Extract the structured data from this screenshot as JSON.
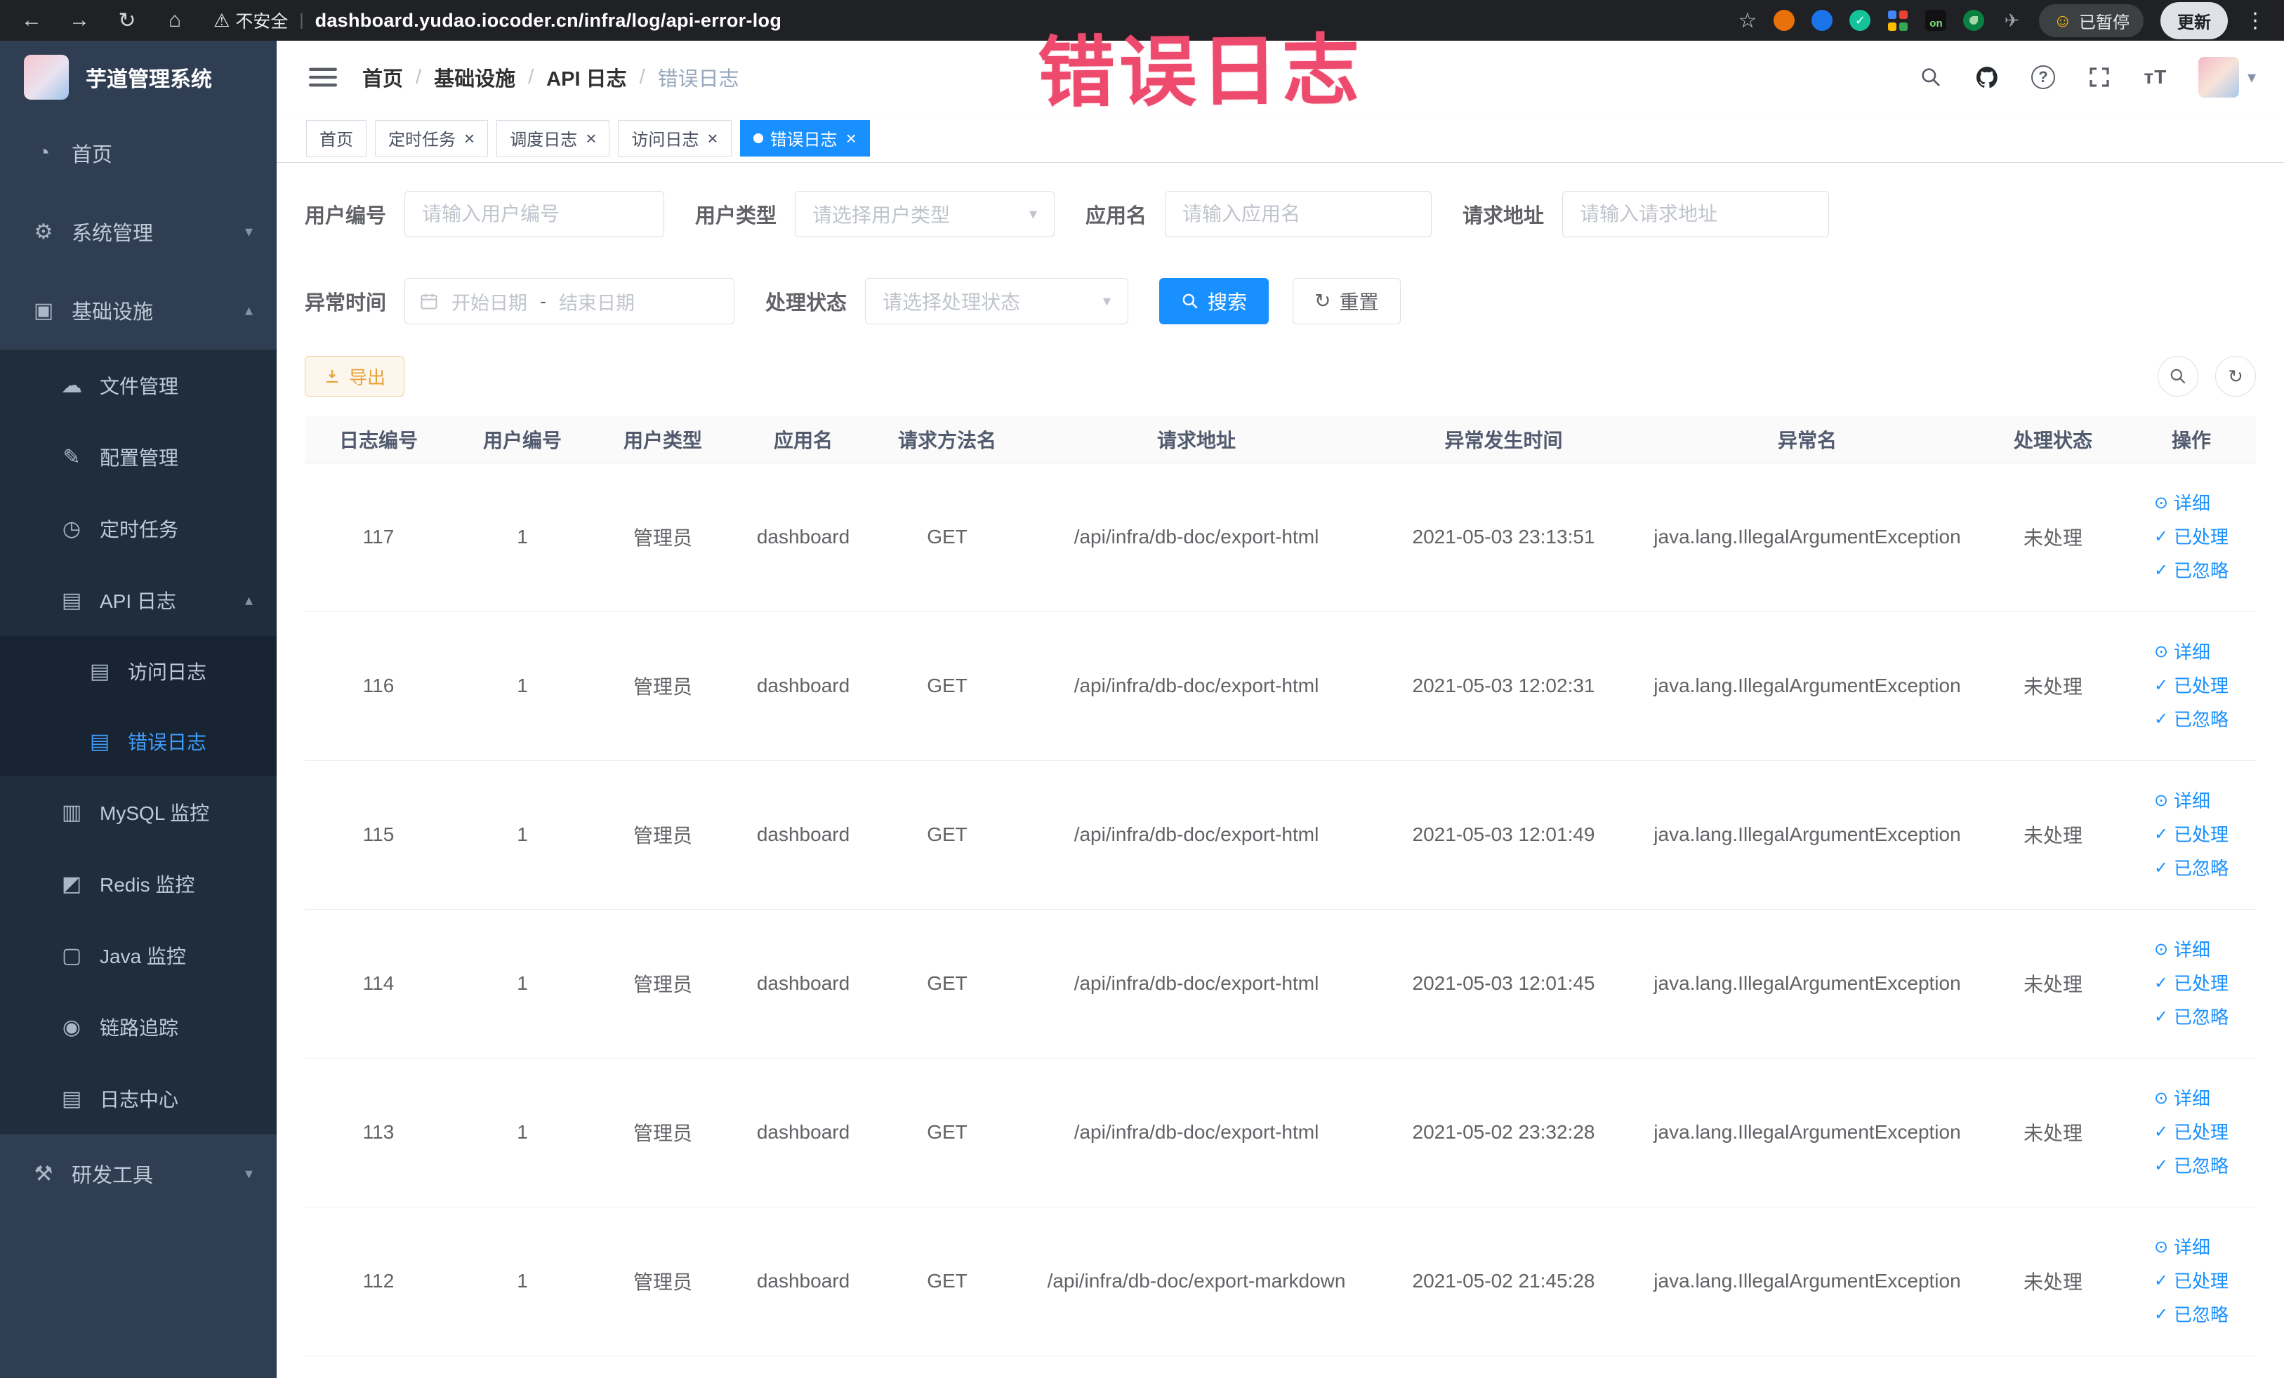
{
  "annotation": {
    "text": "错误日志",
    "color": "#ee4a6e"
  },
  "browser": {
    "security_warning": "不安全",
    "url": "dashboard.yudao.iocoder.cn/infra/log/api-error-log",
    "on_badge": "on",
    "paused_badge": "已暂停",
    "update_button": "更新"
  },
  "sidebar": {
    "app_title": "芋道管理系统",
    "home": "首页",
    "system_management": "系统管理",
    "infrastructure": "基础设施",
    "file_management": "文件管理",
    "config_management": "配置管理",
    "scheduled_jobs": "定时任务",
    "api_logs": "API 日志",
    "access_log": "访问日志",
    "error_log": "错误日志",
    "mysql_monitor": "MySQL 监控",
    "redis_monitor": "Redis 监控",
    "java_monitor": "Java 监控",
    "trace": "链路追踪",
    "log_center": "日志中心",
    "dev_tools": "研发工具"
  },
  "header": {
    "breadcrumb": [
      "首页",
      "基础设施",
      "API 日志",
      "错误日志"
    ]
  },
  "tabs": [
    {
      "label": "首页",
      "closable": false,
      "active": false
    },
    {
      "label": "定时任务",
      "closable": true,
      "active": false
    },
    {
      "label": "调度日志",
      "closable": true,
      "active": false
    },
    {
      "label": "访问日志",
      "closable": true,
      "active": false
    },
    {
      "label": "错误日志",
      "closable": true,
      "active": true
    }
  ],
  "filters": {
    "user_id": {
      "label": "用户编号",
      "placeholder": "请输入用户编号"
    },
    "user_type": {
      "label": "用户类型",
      "placeholder": "请选择用户类型"
    },
    "app_name": {
      "label": "应用名",
      "placeholder": "请输入应用名"
    },
    "request_url": {
      "label": "请求地址",
      "placeholder": "请输入请求地址"
    },
    "exception_time": {
      "label": "异常时间",
      "start_placeholder": "开始日期",
      "separator": "-",
      "end_placeholder": "结束日期"
    },
    "process_status": {
      "label": "处理状态",
      "placeholder": "请选择处理状态"
    },
    "search_button": "搜索",
    "reset_button": "重置"
  },
  "toolbar": {
    "export_button": "导出"
  },
  "table": {
    "columns": [
      "日志编号",
      "用户编号",
      "用户类型",
      "应用名",
      "请求方法名",
      "请求地址",
      "异常发生时间",
      "异常名",
      "处理状态",
      "操作"
    ],
    "actions": {
      "detail": "详细",
      "processed": "已处理",
      "ignored": "已忽略"
    },
    "rows": [
      {
        "id": "117",
        "user_id": "1",
        "user_type": "管理员",
        "app": "dashboard",
        "method": "GET",
        "url": "/api/infra/db-doc/export-html",
        "time": "2021-05-03 23:13:51",
        "exception": "java.lang.IllegalArgumentException",
        "status": "未处理"
      },
      {
        "id": "116",
        "user_id": "1",
        "user_type": "管理员",
        "app": "dashboard",
        "method": "GET",
        "url": "/api/infra/db-doc/export-html",
        "time": "2021-05-03 12:02:31",
        "exception": "java.lang.IllegalArgumentException",
        "status": "未处理"
      },
      {
        "id": "115",
        "user_id": "1",
        "user_type": "管理员",
        "app": "dashboard",
        "method": "GET",
        "url": "/api/infra/db-doc/export-html",
        "time": "2021-05-03 12:01:49",
        "exception": "java.lang.IllegalArgumentException",
        "status": "未处理"
      },
      {
        "id": "114",
        "user_id": "1",
        "user_type": "管理员",
        "app": "dashboard",
        "method": "GET",
        "url": "/api/infra/db-doc/export-html",
        "time": "2021-05-03 12:01:45",
        "exception": "java.lang.IllegalArgumentException",
        "status": "未处理"
      },
      {
        "id": "113",
        "user_id": "1",
        "user_type": "管理员",
        "app": "dashboard",
        "method": "GET",
        "url": "/api/infra/db-doc/export-html",
        "time": "2021-05-02 23:32:28",
        "exception": "java.lang.IllegalArgumentException",
        "status": "未处理"
      },
      {
        "id": "112",
        "user_id": "1",
        "user_type": "管理员",
        "app": "dashboard",
        "method": "GET",
        "url": "/api/infra/db-doc/export-markdown",
        "time": "2021-05-02 21:45:28",
        "exception": "java.lang.IllegalArgumentException",
        "status": "未处理"
      }
    ]
  },
  "colors": {
    "primary": "#1890ff",
    "menu_active": "#409eff",
    "annotation": "#ee4a6e",
    "export_text": "#e6a23c"
  }
}
